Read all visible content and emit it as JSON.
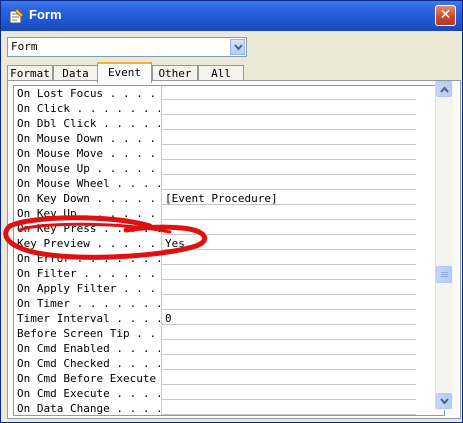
{
  "window": {
    "title": "Form"
  },
  "combo": {
    "value": "Form"
  },
  "tabs": [
    {
      "label": "Format",
      "active": false
    },
    {
      "label": "Data",
      "active": false
    },
    {
      "label": "Event",
      "active": true
    },
    {
      "label": "Other",
      "active": false
    },
    {
      "label": "All",
      "active": false
    }
  ],
  "properties": [
    {
      "name": "On Lost Focus",
      "dots": " . . . . .",
      "value": ""
    },
    {
      "name": "On Click",
      "dots": " . . . . . . .",
      "value": ""
    },
    {
      "name": "On Dbl Click",
      "dots": " . . . . . .",
      "value": ""
    },
    {
      "name": "On Mouse Down",
      "dots": " . . . . .",
      "value": ""
    },
    {
      "name": "On Mouse Move",
      "dots": " . . . . .",
      "value": ""
    },
    {
      "name": "On Mouse Up",
      "dots": " . . . . . .",
      "value": ""
    },
    {
      "name": "On Mouse Wheel",
      "dots": " . . . . .",
      "value": ""
    },
    {
      "name": "On Key Down",
      "dots": " . . . . . .",
      "value": "[Event Procedure]"
    },
    {
      "name": "On Key Up",
      "dots": " . . . . . . .",
      "value": ""
    },
    {
      "name": "On Key Press",
      "dots": " . . . . .",
      "value": ""
    },
    {
      "name": "Key Preview",
      "dots": " . . . . . .",
      "value": "Yes"
    },
    {
      "name": "On Error",
      "dots": " . . . . . . .",
      "value": ""
    },
    {
      "name": "On Filter",
      "dots": " . . . . . . .",
      "value": ""
    },
    {
      "name": "On Apply Filter",
      "dots": " . . . . .",
      "value": ""
    },
    {
      "name": "On Timer",
      "dots": " . . . . . . .",
      "value": ""
    },
    {
      "name": "Timer Interval",
      "dots": " . . . . .",
      "value": "0"
    },
    {
      "name": "Before Screen Tip",
      "dots": " . . . .",
      "value": ""
    },
    {
      "name": "On Cmd Enabled",
      "dots": " . . . . .",
      "value": ""
    },
    {
      "name": "On Cmd Checked",
      "dots": " . . . . .",
      "value": ""
    },
    {
      "name": "On Cmd Before Execute",
      "dots": " .",
      "value": ""
    },
    {
      "name": "On Cmd Execute",
      "dots": " . . . . .",
      "value": ""
    },
    {
      "name": "On Data Change",
      "dots": " . . . . .",
      "value": ""
    }
  ],
  "annotation": {
    "color": "#e01010"
  },
  "icons": {
    "app": "property-sheet-icon",
    "close": "close-icon",
    "dropdown": "chevron-down-icon",
    "scroll_up": "scroll-up-icon",
    "scroll_down": "scroll-down-icon"
  }
}
